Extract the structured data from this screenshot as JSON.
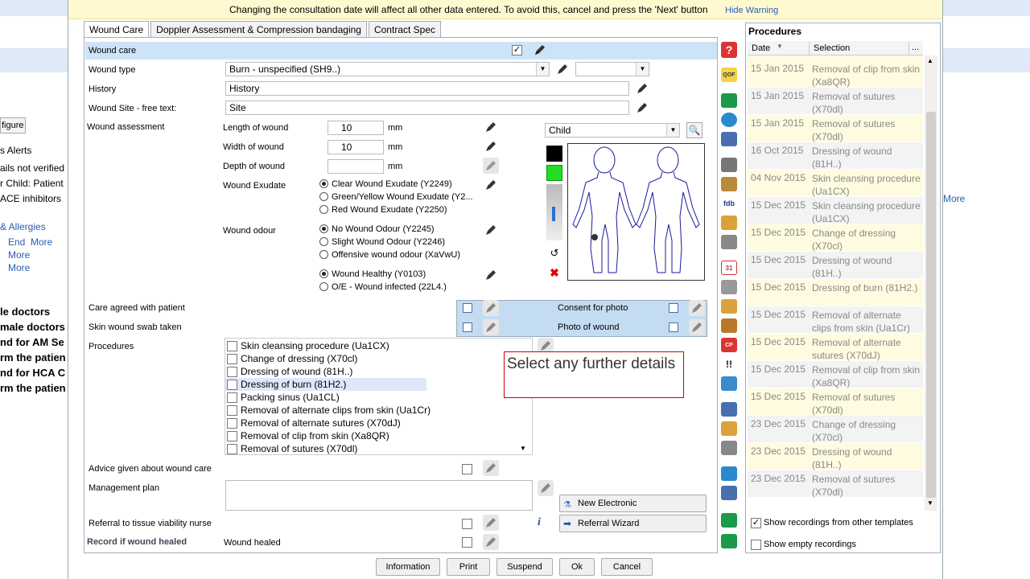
{
  "background_left": {
    "figure_label": "figure",
    "alerts": "s Alerts",
    "lines": [
      "ails not verified",
      "r Child: Patient",
      "ACE inhibitors"
    ],
    "allergies": "& Allergies",
    "end_more": [
      "End",
      "More"
    ],
    "more1": "More",
    "more2": "More",
    "bold_lines": [
      "le doctors",
      "male doctors",
      "nd for AM Se",
      "rm the patien",
      "nd for HCA C",
      "rm the patien"
    ]
  },
  "background_right": {
    "more": "More"
  },
  "warning": {
    "text": "Changing the consultation date will affect all other data entered. To avoid this, cancel and press the 'Next' button",
    "hide_link": "Hide Warning"
  },
  "tabs": [
    "Wound Care",
    "Doppler Assessment & Compression bandaging",
    "Contract Spec"
  ],
  "form": {
    "wound_care_label": "Wound care",
    "wound_type_label": "Wound type",
    "wound_type_value": "Burn - unspecified (SH9..)",
    "history_label": "History",
    "history_value": "History",
    "site_label": "Wound Site - free text:",
    "site_value": "Site",
    "assessment_label": "Wound assessment",
    "length_label": "Length of wound",
    "length_value": "10",
    "width_label": "Width of wound",
    "width_value": "10",
    "depth_label": "Depth of wound",
    "depth_value": "",
    "unit": "mm",
    "exudate_label": "Wound Exudate",
    "exudate_options": [
      {
        "label": "Clear Wound Exudate (Y2249)",
        "checked": true
      },
      {
        "label": "Green/Yellow Wound Exudate (Y2...",
        "checked": false
      },
      {
        "label": "Red Wound Exudate (Y2250)",
        "checked": false
      }
    ],
    "odour_label": "Wound odour",
    "odour_options": [
      {
        "label": "No Wound Odour (Y2245)",
        "checked": true
      },
      {
        "label": "Slight Wound Odour (Y2246)",
        "checked": false
      },
      {
        "label": "Offensive wound odour (XaVwU)",
        "checked": false
      }
    ],
    "health_options": [
      {
        "label": "Wound Healthy (Y0103)",
        "checked": true
      },
      {
        "label": "O/E - Wound infected (22L4.)",
        "checked": false
      }
    ],
    "body_map_select": "Child",
    "care_agreed_label": "Care agreed with patient",
    "swab_label": "Skin wound swab taken",
    "consent_label": "Consent for photo",
    "photo_label": "Photo of wound",
    "procedures_label": "Procedures",
    "procedures": [
      "Skin cleansing procedure (Ua1CX)",
      "Change of dressing (X70cl)",
      "Dressing of wound (81H..)",
      "Dressing of burn (81H2.)",
      "Packing sinus (Ua1CL)",
      "Removal of alternate clips from skin (Ua1Cr)",
      "Removal of alternate sutures (X70dJ)",
      "Removal of clip from skin (Xa8QR)",
      "Removal of sutures (X70dl)"
    ],
    "tooltip": "Select any further details",
    "advice_label": "Advice given about wound care",
    "management_label": "Management plan",
    "referral_label": "Referral to tissue viability nurse",
    "healed_section_label": "Record if wound healed",
    "healed_label": "Wound healed",
    "pathology_button": "New Electronic Pathology/Radi...",
    "referral_wizard_button": "Referral Wizard"
  },
  "footer_buttons": [
    "Information",
    "Print",
    "Suspend",
    "Ok",
    "Cancel"
  ],
  "procedures_panel": {
    "title": "Procedures",
    "col_date": "Date",
    "col_selection": "Selection",
    "col_more": "...",
    "rows": [
      {
        "date": "15 Jan 2015",
        "selection": "Removal of clip from skin (Xa8QR)"
      },
      {
        "date": "15 Jan 2015",
        "selection": "Removal of sutures (X70dl)"
      },
      {
        "date": "15 Jan 2015",
        "selection": "Removal of sutures (X70dl)"
      },
      {
        "date": "16 Oct 2015",
        "selection": "Dressing of wound (81H..)"
      },
      {
        "date": "04 Nov 2015",
        "selection": "Skin cleansing procedure (Ua1CX)"
      },
      {
        "date": "15 Dec 2015",
        "selection": "Skin cleansing procedure (Ua1CX)"
      },
      {
        "date": "15 Dec 2015",
        "selection": "Change of dressing (X70cl)"
      },
      {
        "date": "15 Dec 2015",
        "selection": "Dressing of wound (81H..)"
      },
      {
        "date": "15 Dec 2015",
        "selection": "Dressing of burn (81H2.)"
      },
      {
        "date": "15 Dec 2015",
        "selection": "Removal of alternate clips from skin (Ua1Cr)"
      },
      {
        "date": "15 Dec 2015",
        "selection": "Removal of alternate sutures (X70dJ)"
      },
      {
        "date": "15 Dec 2015",
        "selection": "Removal of clip from skin (Xa8QR)"
      },
      {
        "date": "15 Dec 2015",
        "selection": "Removal of sutures (X70dl)"
      },
      {
        "date": "23 Dec 2015",
        "selection": "Change of dressing (X70cl)"
      },
      {
        "date": "23 Dec 2015",
        "selection": "Dressing of wound (81H..)"
      },
      {
        "date": "23 Dec 2015",
        "selection": "Removal of sutures (X70dl)"
      }
    ],
    "show_other": "Show recordings from other templates",
    "show_other_checked": true,
    "show_empty": "Show empty recordings",
    "show_empty_checked": false
  },
  "side_icons": [
    "help-icon",
    "qof-icon",
    "green-folder-icon",
    "globe-icon",
    "car-icon",
    "bottle-icon",
    "pill-icon",
    "fdb-icon",
    "warning-icon",
    "printer-icon",
    "calendar-icon",
    "speaker-icon",
    "notes-icon",
    "share-icon",
    "cp-icon",
    "alert-icon",
    "person-icon",
    "document-icon",
    "envelope-icon",
    "box-icon",
    "flask-icon",
    "chart-icon",
    "exit-icon",
    "exit-icon-2"
  ],
  "side_icon_texts": {
    "help": "?",
    "qof": "QOF",
    "fdb": "fdb",
    "calendar": "31",
    "alert": "!!",
    "cp": "CP"
  }
}
